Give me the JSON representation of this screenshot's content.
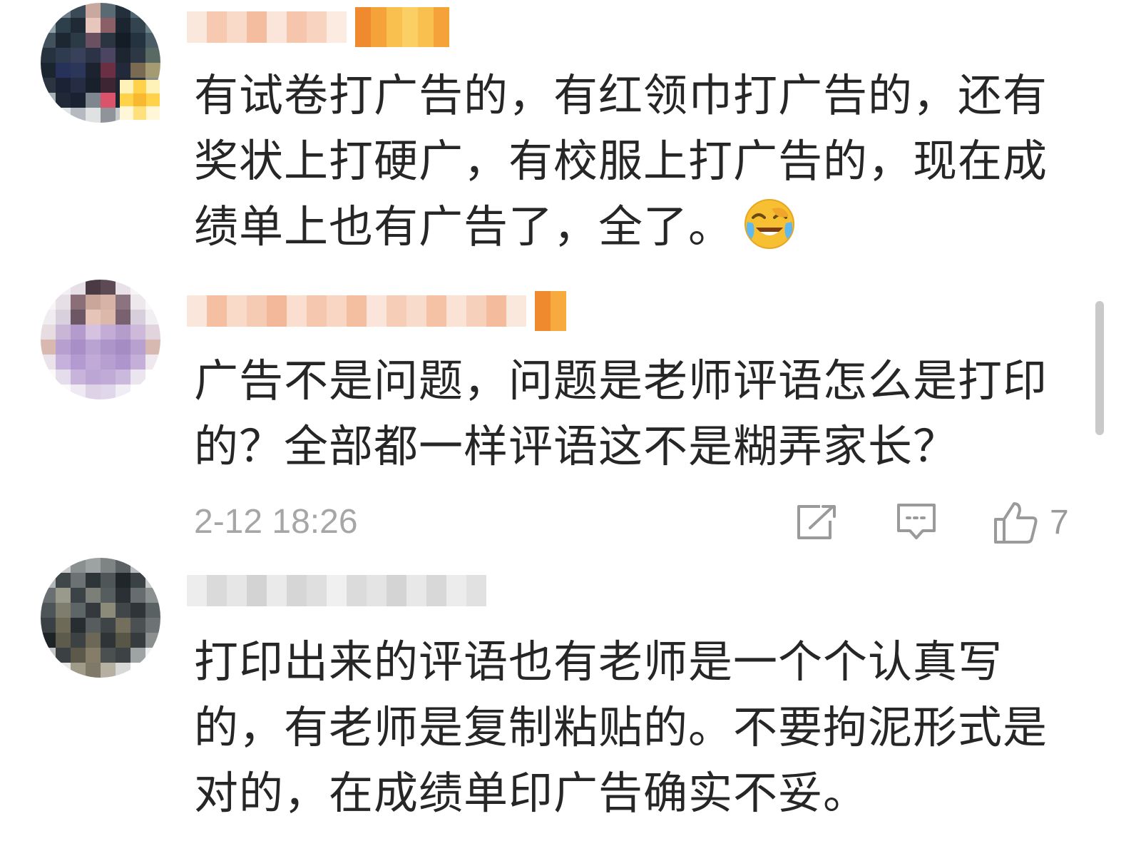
{
  "comments": [
    {
      "text_lines": [
        "有试卷打广告的，有红领巾打广告的，还有",
        "奖状上打硬广，有校服上打广告的，现在成",
        "绩单上也有广告了，全了。"
      ],
      "emoji_icon": "face-with-tears-of-joy-icon"
    },
    {
      "text_lines": [
        "广告不是问题，问题是老师评语怎么是打印",
        "的？全部都一样评语这不是糊弄家长？"
      ],
      "timestamp": "2-12 18:26",
      "like_count": "7"
    },
    {
      "text_lines": [
        "打印出来的评语也有老师是一个个认真写",
        "的，有老师是复制粘贴的。不要拘泥形式是",
        "对的，在成绩单印广告确实不妥。"
      ]
    }
  ],
  "icons": {
    "share": "share-icon",
    "comment": "comment-icon",
    "like": "thumbs-up-icon"
  },
  "colors": {
    "text": "#262626",
    "meta": "#a6a6a6",
    "icon": "#9a9a9a",
    "badge_orange": "#f29a3a"
  }
}
